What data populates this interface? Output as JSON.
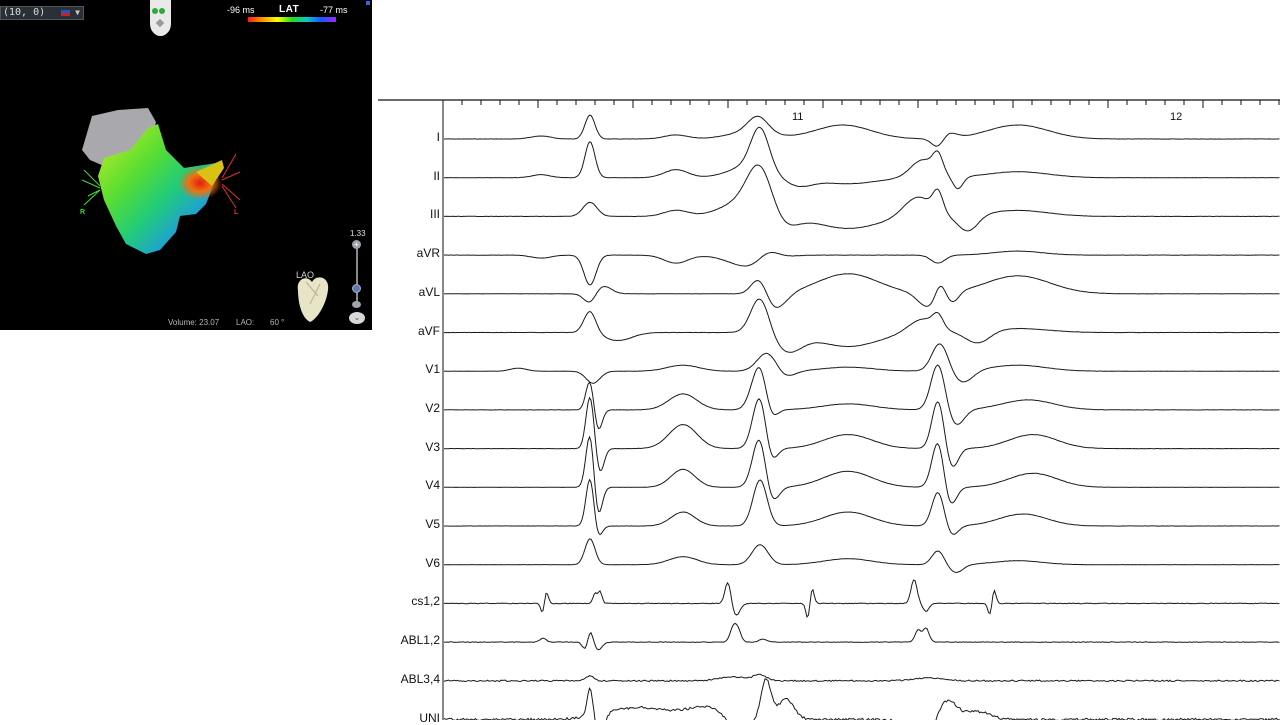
{
  "map_panel": {
    "coordinate_display": "(10, 0)",
    "map_type": "LAT",
    "lat_min": "-96 ms",
    "lat_max": "-77 ms",
    "zoom_value": "1.33",
    "view_label": "LAO",
    "volume_label": "Volume: 23.07",
    "view_status": "LAO:",
    "view_angle": "60 °",
    "axis_right": "R",
    "axis_left": "L",
    "plus_glyph": "+",
    "view_glyph": "⌄",
    "colors": {
      "background": "#000000",
      "lat_scale": [
        "#ff1a1a",
        "#ff9a00",
        "#ffff00",
        "#22dd22",
        "#00cccc",
        "#1a55ff",
        "#9a2aff"
      ],
      "axis_right": "#3ddc3d",
      "axis_left": "#e03030"
    },
    "icons": [
      "orientation-head-icon",
      "heart-model-icon",
      "zoom-slider",
      "view-toggle-icon",
      "flag-icon",
      "chevron-down-icon"
    ]
  },
  "ecg_panel": {
    "time_markers": [
      "11",
      "12"
    ],
    "leads": [
      "I",
      "II",
      "III",
      "aVR",
      "aVL",
      "aVF",
      "V1",
      "V2",
      "V3",
      "V4",
      "V5",
      "V6",
      "cs1,2",
      "ABL1,2",
      "ABL3,4",
      "UNI"
    ],
    "colors": {
      "trace": "#1a1a1a",
      "axis": "#111111",
      "background": "#ffffff"
    }
  }
}
